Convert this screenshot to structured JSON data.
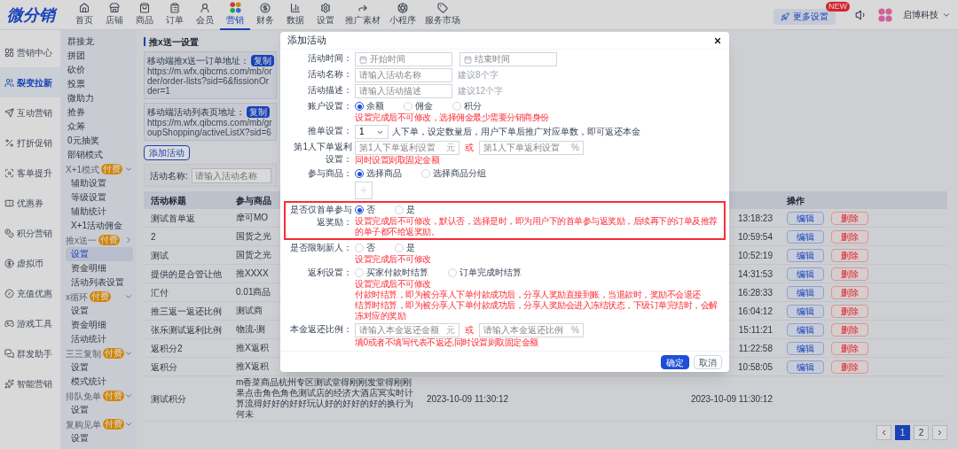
{
  "top_nav": {
    "logo": "微分销",
    "items": [
      {
        "label": "首页",
        "selected": false
      },
      {
        "label": "店铺",
        "selected": false
      },
      {
        "label": "商品",
        "selected": false
      },
      {
        "label": "订单",
        "selected": false
      },
      {
        "label": "会员",
        "selected": false
      },
      {
        "label": "营销",
        "selected": true
      },
      {
        "label": "财务",
        "selected": false
      },
      {
        "label": "数据",
        "selected": false
      },
      {
        "label": "设置",
        "selected": false
      },
      {
        "label": "推广素材",
        "selected": false
      },
      {
        "label": "小程序",
        "selected": false
      },
      {
        "label": "服务市场",
        "selected": false
      }
    ],
    "promo": {
      "label": "更多设置",
      "badge": "NEW"
    },
    "account": "启博科技"
  },
  "main_menu": [
    {
      "label": "营销中心",
      "selected": false
    },
    {
      "label": "裂变拉新",
      "selected": true
    },
    {
      "label": "互动营销",
      "selected": false
    },
    {
      "label": "打折促销",
      "selected": false
    },
    {
      "label": "客单提升",
      "selected": false
    },
    {
      "label": "优惠券",
      "selected": false
    },
    {
      "label": "积分营销",
      "selected": false
    },
    {
      "label": "虚拟币",
      "selected": false
    },
    {
      "label": "充值优惠",
      "selected": false
    },
    {
      "label": "游戏工具",
      "selected": false
    },
    {
      "label": "群发助手",
      "selected": false
    },
    {
      "label": "智能营销",
      "selected": false
    }
  ],
  "sub_menu": [
    {
      "label": "群接龙",
      "selected": false
    },
    {
      "label": "拼团",
      "selected": false
    },
    {
      "label": "砍价",
      "selected": false
    },
    {
      "label": "投票",
      "selected": false
    },
    {
      "label": "微助力",
      "selected": false
    },
    {
      "label": "抢券",
      "selected": false
    },
    {
      "label": "众筹",
      "selected": false
    },
    {
      "label": "0元抽奖",
      "selected": false
    },
    {
      "label": "部销模式",
      "selected": false
    },
    {
      "label": "X+1模式",
      "badge": "付费",
      "expanded": true,
      "children": [
        {
          "label": "辅助设置",
          "selected": false
        },
        {
          "label": "等级设置",
          "selected": false
        },
        {
          "label": "辅助统计",
          "selected": false
        },
        {
          "label": "X+1活动佣金",
          "selected": false
        }
      ]
    },
    {
      "label": "推x送一",
      "badge": "付费",
      "expanded": false,
      "children": [
        {
          "label": "设置",
          "selected": true
        },
        {
          "label": "资金明细",
          "selected": false
        },
        {
          "label": "活动列表设置",
          "selected": false
        }
      ]
    },
    {
      "label": "x循环",
      "badge": "付费",
      "expanded": true,
      "children": [
        {
          "label": "设置",
          "selected": false
        },
        {
          "label": "资金明细",
          "selected": false
        },
        {
          "label": "活动统计",
          "selected": false
        }
      ]
    },
    {
      "label": "三三复制",
      "badge": "付费",
      "expanded": true,
      "children": [
        {
          "label": "设置",
          "selected": false
        },
        {
          "label": "模式统计",
          "selected": false
        }
      ]
    },
    {
      "label": "排队免单",
      "badge": "付费",
      "expanded": true,
      "children": [
        {
          "label": "设置",
          "selected": false
        }
      ]
    },
    {
      "label": "复购见单",
      "badge": "付费",
      "expanded": true,
      "children": [
        {
          "label": "设置",
          "selected": false
        }
      ]
    }
  ],
  "page": {
    "breadcrumb": "推x送一设置",
    "links": [
      {
        "title": "移动端推x送一订单地址：",
        "url": "https://m.wfx.qibcms.com/mb/order/order-lists?sid=6&fissionOrder=1",
        "button": "复制"
      },
      {
        "title": "移动端活动列表页地址：",
        "url": "https://m.wfx.qibcms.com/mb/groupShopping/activeListX?sid=6",
        "button": "复制"
      }
    ],
    "add_button": "添加活动",
    "search": {
      "label": "活动名称:",
      "placeholder": "请输入活动名称"
    }
  },
  "table": {
    "header": {
      "title": "活动标题",
      "goods": "参与商品",
      "actions": "操作"
    },
    "rows": [
      {
        "title": "测试首单返",
        "goods": "摩可MO",
        "end": "13:18:23",
        "actions": [
          {
            "label": "编辑",
            "kind": "edit"
          },
          {
            "label": "删除",
            "kind": "delete"
          }
        ]
      },
      {
        "title": "2",
        "goods": "国货之光",
        "end": "10:59:54",
        "actions": [
          {
            "label": "编辑",
            "kind": "edit"
          },
          {
            "label": "删除",
            "kind": "delete"
          }
        ]
      },
      {
        "title": "测试",
        "goods": "国货之光",
        "end": "10:52:19",
        "actions": [
          {
            "label": "编辑",
            "kind": "edit"
          },
          {
            "label": "删除",
            "kind": "delete"
          }
        ]
      },
      {
        "title": "提供的是合管让他",
        "goods": "推XXXX",
        "end": "14:31:53",
        "actions": [
          {
            "label": "编辑",
            "kind": "edit"
          },
          {
            "label": "删除",
            "kind": "delete"
          }
        ]
      },
      {
        "title": "汇付",
        "goods": "0.01商品",
        "end": "16:28:33",
        "actions": [
          {
            "label": "编辑",
            "kind": "edit"
          },
          {
            "label": "删除",
            "kind": "delete"
          }
        ]
      },
      {
        "title": "推三返一返还比例",
        "goods": "测试商",
        "end": "16:04:12",
        "actions": [
          {
            "label": "编辑",
            "kind": "edit"
          },
          {
            "label": "删除",
            "kind": "delete"
          }
        ]
      },
      {
        "title": "张乐测试返利比例",
        "goods": "物流-测",
        "end": "15:11:21",
        "actions": [
          {
            "label": "编辑",
            "kind": "edit"
          },
          {
            "label": "删除",
            "kind": "delete"
          }
        ]
      },
      {
        "title": "返积分2",
        "goods": "推X返积",
        "end": "11:22:58",
        "actions": [
          {
            "label": "编辑",
            "kind": "edit"
          },
          {
            "label": "删除",
            "kind": "delete"
          }
        ]
      },
      {
        "title": "返积分",
        "goods": "推X返积",
        "end": "10:58:05",
        "actions": [
          {
            "label": "编辑",
            "kind": "edit"
          },
          {
            "label": "删除",
            "kind": "delete"
          }
        ]
      },
      {
        "title": "测试积分",
        "goods": "m香菜商品杭州专区测试堂得刚刚发堂得刚刚果点击角色角色测试店的经济大酒店冥实时计算流得好好的好好玩认好的好好的好的换行为何未",
        "start": "2023-10-09 11:30:12",
        "end": "2023-10-09 11:30:12",
        "actions": []
      }
    ],
    "pages": [
      {
        "label": "1",
        "selected": true
      },
      {
        "label": "2",
        "selected": false
      }
    ]
  },
  "modal": {
    "title": "添加活动",
    "fields": [
      {
        "kind": "dates",
        "label": "活动时间：",
        "highlighted": false,
        "placeholders": [
          "开始时间",
          "结束时间"
        ]
      },
      {
        "kind": "text",
        "label": "活动名称：",
        "highlighted": false,
        "placeholder": "请输入活动名称",
        "hint": "建议8个字"
      },
      {
        "kind": "text",
        "label": "活动描述：",
        "highlighted": false,
        "placeholder": "请输入活动描述",
        "hint": "建议12个字"
      },
      {
        "kind": "radios",
        "label": "账户设置：",
        "highlighted": false,
        "options": [
          {
            "label": "余额",
            "selected": true
          },
          {
            "label": "佣金",
            "selected": false
          },
          {
            "label": "积分",
            "selected": false
          }
        ],
        "notes": [
          "设置完成后不可修改，选择佣金最少需要分销商身份"
        ]
      },
      {
        "kind": "select",
        "label": "推单设置：",
        "highlighted": false,
        "value": "1",
        "text": "人下单，设定数量后，用户下单后推广对应单数，即可返还本金"
      },
      {
        "kind": "amounts",
        "label": "第1人下单返利设置：",
        "highlighted": false,
        "inputs": [
          {
            "placeholder": "第1人下单返利设置",
            "unit": "元"
          },
          {
            "placeholder": "第1人下单返利设置",
            "unit": "%"
          }
        ],
        "separator": "或",
        "notes": [
          "同时设置则取固定金额"
        ]
      },
      {
        "kind": "goods",
        "label": "参与商品：",
        "highlighted": false,
        "options": [
          {
            "label": "选择商品",
            "selected": true
          },
          {
            "label": "选择商品分组",
            "selected": false
          }
        ]
      },
      {
        "kind": "radios",
        "label": "是否仅首单参与返奖励：",
        "highlighted": true,
        "options": [
          {
            "label": "否",
            "selected": true
          },
          {
            "label": "是",
            "selected": false
          }
        ],
        "notes": [
          "设置完成后不可修改，默认否，选择是时，即为用户下的首单参与返奖励，后续再下的订单及推荐的单子都不给返奖励。"
        ]
      },
      {
        "kind": "radios",
        "label": "是否限制新人：",
        "highlighted": false,
        "options": [
          {
            "label": "否",
            "selected": false
          },
          {
            "label": "是",
            "selected": false
          }
        ],
        "notes": [
          "设置完成后不可修改"
        ]
      },
      {
        "kind": "radios",
        "label": "返利设置：",
        "highlighted": false,
        "options": [
          {
            "label": "买家付款时结算",
            "selected": false
          },
          {
            "label": "订单完成时结算",
            "selected": false
          }
        ],
        "notes": [
          "设置完成后不可修改",
          "付款时结算，即为被分享人下单付款成功后，分享人奖励直接到账，当退款时，奖励不会退还",
          "结算时结算，即为被分享人下单付款成功后，分享人奖励会进入冻结状态，下级订单完结时，会解冻对应的奖励"
        ]
      },
      {
        "kind": "amounts",
        "label": "本金返还比例：",
        "highlighted": false,
        "inputs": [
          {
            "placeholder": "请输入本金返还金额",
            "unit": "元"
          },
          {
            "placeholder": "请输入本金返还比例",
            "unit": "%"
          }
        ],
        "separator": "或",
        "notes": [
          "填0或者不填写代表不返还,同时设置则取固定金额"
        ]
      }
    ],
    "buttons": [
      {
        "label": "确定",
        "kind": "primary"
      },
      {
        "label": "取消",
        "kind": "default"
      }
    ]
  }
}
